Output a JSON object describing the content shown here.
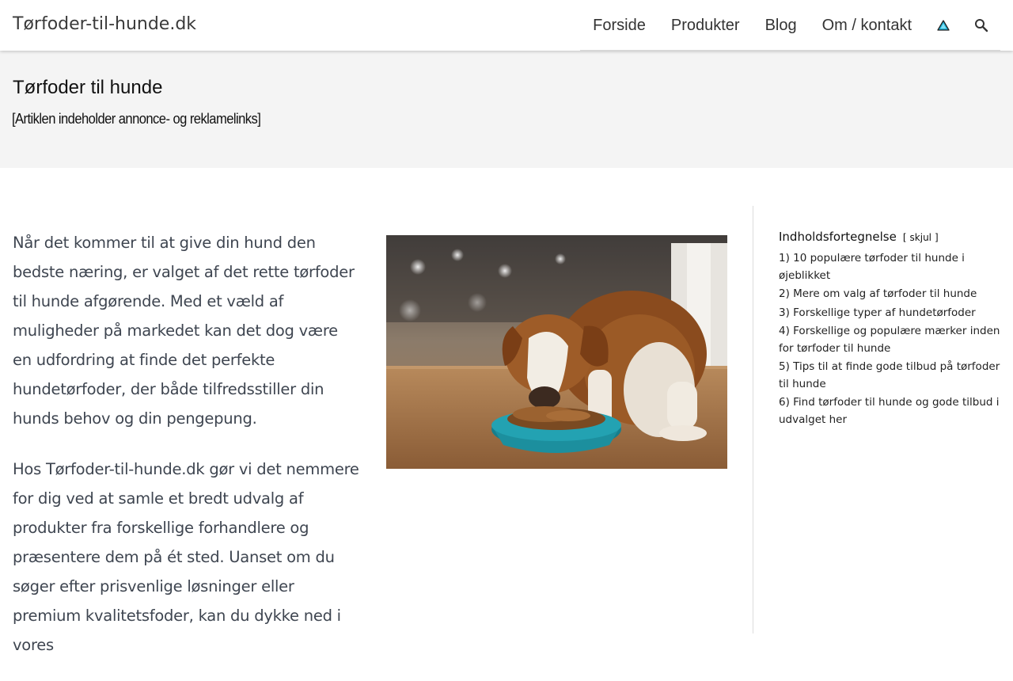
{
  "header": {
    "site_title": "Tørfoder-til-hunde.dk",
    "nav": [
      {
        "label": "Forside"
      },
      {
        "label": "Produkter"
      },
      {
        "label": "Blog"
      },
      {
        "label": "Om / kontakt"
      }
    ],
    "icons": [
      "warning-triangle-icon",
      "search-icon"
    ]
  },
  "hero": {
    "title": "Tørfoder til hunde",
    "disclaimer": "[Artiklen indeholder annonce- og reklamelinks]"
  },
  "article": {
    "paragraphs": [
      "Når det kommer til at give din hund den bedste næring, er valget af det rette tørfoder til hunde afgørende. Med et væld af muligheder på markedet kan det dog være en udfordring at finde det perfekte hundetørfoder, der både tilfredsstiller din hunds behov og din pengepung.",
      "Hos Tørfoder-til-hunde.dk gør vi det nemmere for dig ved at samle et bredt udvalg af produkter fra forskellige forhandlere og præsentere dem på ét sted. Uanset om du søger efter prisvenlige løsninger eller premium kvalitetsfoder, kan du dykke ned i vores"
    ]
  },
  "toc": {
    "title": "Indholdsfortegnelse",
    "toggle_open": "[",
    "toggle_label": "skjul",
    "toggle_close": "]",
    "items": [
      "1) 10 populære tørfoder til hunde i øjeblikket",
      "2) Mere om valg af tørfoder til hunde",
      "3) Forskellige typer af hundetørfoder",
      "4) Forskellige og populære mærker inden for tørfoder til hunde",
      "5) Tips til at finde gode tilbud på tørfoder til hunde",
      "6) Find tørfoder til hunde og gode tilbud i udvalget her"
    ]
  },
  "colors": {
    "hero_bg": "#f4f4f4",
    "body_text": "#3e4550",
    "bowl": "#1c8f9e",
    "dog_brown": "#8a4b1e",
    "warning_icon": "#1fb1d6"
  }
}
